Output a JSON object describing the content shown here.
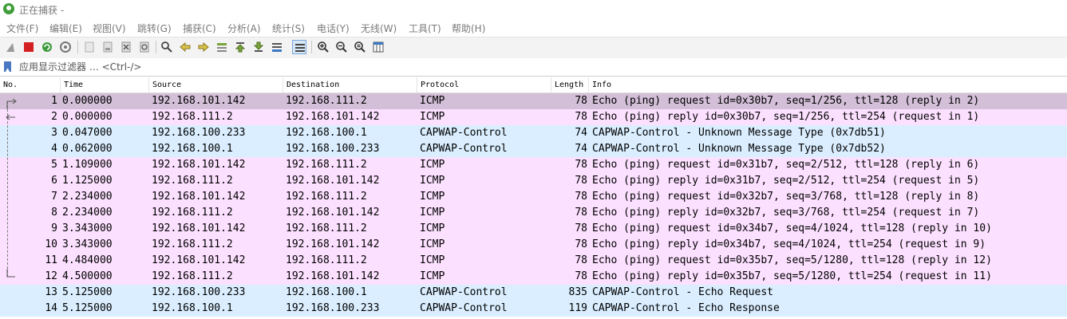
{
  "window": {
    "title": "正在捕获 -"
  },
  "menu": [
    {
      "label": "文件(F)"
    },
    {
      "label": "编辑(E)"
    },
    {
      "label": "视图(V)"
    },
    {
      "label": "跳转(G)"
    },
    {
      "label": "捕获(C)"
    },
    {
      "label": "分析(A)"
    },
    {
      "label": "统计(S)"
    },
    {
      "label": "电话(Y)"
    },
    {
      "label": "无线(W)"
    },
    {
      "label": "工具(T)"
    },
    {
      "label": "帮助(H)"
    }
  ],
  "toolbar": {
    "buttons": [
      "shark-fin-icon",
      "stop-icon",
      "restart-icon",
      "options-gear-icon",
      "open-file-icon",
      "save-file-icon",
      "close-file-icon",
      "reload-icon",
      "find-icon",
      "go-back-icon",
      "go-forward-icon",
      "go-to-packet-icon",
      "first-packet-icon",
      "last-packet-icon",
      "autoscroll-icon",
      "colorize-icon",
      "zoom-in-icon",
      "zoom-out-icon",
      "zoom-normal-icon",
      "resize-columns-icon"
    ]
  },
  "filter": {
    "placeholder": "应用显示过滤器 … <Ctrl-/>"
  },
  "columns": {
    "no": "No.",
    "time": "Time",
    "source": "Source",
    "destination": "Destination",
    "protocol": "Protocol",
    "length": "Length",
    "info": "Info"
  },
  "colors": {
    "icmp_row": "#fce0ff",
    "capwap_row": "#daeeff",
    "selected_row": "#d3bfd8"
  },
  "packets": [
    {
      "no": "1",
      "time": "0.000000",
      "src": "192.168.101.142",
      "dst": "192.168.111.2",
      "proto": "ICMP",
      "len": "78",
      "info": "Echo (ping) request  id=0x30b7, seq=1/256, ttl=128 (reply in 2)",
      "kind": "icmp",
      "selected": true
    },
    {
      "no": "2",
      "time": "0.000000",
      "src": "192.168.111.2",
      "dst": "192.168.101.142",
      "proto": "ICMP",
      "len": "78",
      "info": "Echo (ping) reply    id=0x30b7, seq=1/256, ttl=254 (request in 1)",
      "kind": "icmp"
    },
    {
      "no": "3",
      "time": "0.047000",
      "src": "192.168.100.233",
      "dst": "192.168.100.1",
      "proto": "CAPWAP-Control",
      "len": "74",
      "info": "CAPWAP-Control - Unknown Message Type (0x7db51)",
      "kind": "capwap"
    },
    {
      "no": "4",
      "time": "0.062000",
      "src": "192.168.100.1",
      "dst": "192.168.100.233",
      "proto": "CAPWAP-Control",
      "len": "74",
      "info": "CAPWAP-Control - Unknown Message Type (0x7db52)",
      "kind": "capwap"
    },
    {
      "no": "5",
      "time": "1.109000",
      "src": "192.168.101.142",
      "dst": "192.168.111.2",
      "proto": "ICMP",
      "len": "78",
      "info": "Echo (ping) request  id=0x31b7, seq=2/512, ttl=128 (reply in 6)",
      "kind": "icmp"
    },
    {
      "no": "6",
      "time": "1.125000",
      "src": "192.168.111.2",
      "dst": "192.168.101.142",
      "proto": "ICMP",
      "len": "78",
      "info": "Echo (ping) reply    id=0x31b7, seq=2/512, ttl=254 (request in 5)",
      "kind": "icmp"
    },
    {
      "no": "7",
      "time": "2.234000",
      "src": "192.168.101.142",
      "dst": "192.168.111.2",
      "proto": "ICMP",
      "len": "78",
      "info": "Echo (ping) request  id=0x32b7, seq=3/768, ttl=128 (reply in 8)",
      "kind": "icmp"
    },
    {
      "no": "8",
      "time": "2.234000",
      "src": "192.168.111.2",
      "dst": "192.168.101.142",
      "proto": "ICMP",
      "len": "78",
      "info": "Echo (ping) reply    id=0x32b7, seq=3/768, ttl=254 (request in 7)",
      "kind": "icmp"
    },
    {
      "no": "9",
      "time": "3.343000",
      "src": "192.168.101.142",
      "dst": "192.168.111.2",
      "proto": "ICMP",
      "len": "78",
      "info": "Echo (ping) request  id=0x34b7, seq=4/1024, ttl=128 (reply in 10)",
      "kind": "icmp"
    },
    {
      "no": "10",
      "time": "3.343000",
      "src": "192.168.111.2",
      "dst": "192.168.101.142",
      "proto": "ICMP",
      "len": "78",
      "info": "Echo (ping) reply    id=0x34b7, seq=4/1024, ttl=254 (request in 9)",
      "kind": "icmp"
    },
    {
      "no": "11",
      "time": "4.484000",
      "src": "192.168.101.142",
      "dst": "192.168.111.2",
      "proto": "ICMP",
      "len": "78",
      "info": "Echo (ping) request  id=0x35b7, seq=5/1280, ttl=128 (reply in 12)",
      "kind": "icmp"
    },
    {
      "no": "12",
      "time": "4.500000",
      "src": "192.168.111.2",
      "dst": "192.168.101.142",
      "proto": "ICMP",
      "len": "78",
      "info": "Echo (ping) reply    id=0x35b7, seq=5/1280, ttl=254 (request in 11)",
      "kind": "icmp"
    },
    {
      "no": "13",
      "time": "5.125000",
      "src": "192.168.100.233",
      "dst": "192.168.100.1",
      "proto": "CAPWAP-Control",
      "len": "835",
      "info": "CAPWAP-Control - Echo Request",
      "kind": "capwap"
    },
    {
      "no": "14",
      "time": "5.125000",
      "src": "192.168.100.1",
      "dst": "192.168.100.233",
      "proto": "CAPWAP-Control",
      "len": "119",
      "info": "CAPWAP-Control - Echo Response",
      "kind": "capwap"
    }
  ]
}
